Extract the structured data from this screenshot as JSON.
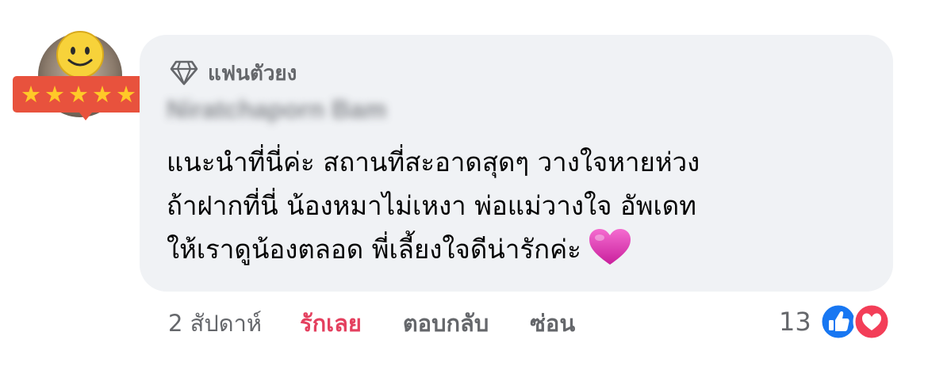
{
  "comment": {
    "badge_label": "แฟนตัวยง",
    "author": "Niratchaporn Bam",
    "lines": [
      "แนะนำที่นี่ค่ะ สถานที่สะอาดสุดๆ วางใจหายห่วง",
      "ถ้าฝากที่นี่  น้องหมาไม่เหงา พ่อแม่วางใจ อัพเดท",
      "ให้เราดูน้องตลอด พี่เลี้ยงใจดีน่ารักค่ะ"
    ],
    "emoji": "heart-emoji"
  },
  "actions": {
    "timestamp": "2 สัปดาห์",
    "like_label": "รักเลย",
    "reply_label": "ตอบกลับ",
    "hide_label": "ซ่อน"
  },
  "reactions": {
    "count": "13",
    "types": [
      "like-icon",
      "love-icon"
    ]
  },
  "avatar": {
    "stars": 5
  },
  "colors": {
    "bubble_bg": "#f0f2f5",
    "like_active": "#e4405f",
    "badge_red": "#e8523d",
    "star_yellow": "#ffc928",
    "like_blue": "#1877f2",
    "love_red": "#f33e58"
  }
}
